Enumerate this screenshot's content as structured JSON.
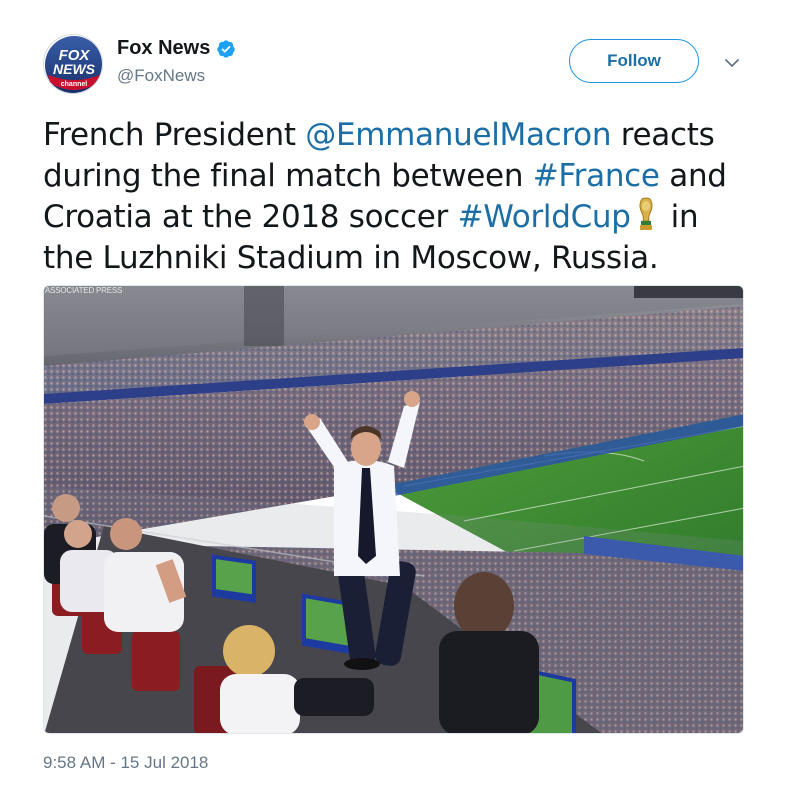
{
  "account": {
    "display_name": "Fox News",
    "handle": "@FoxNews",
    "verified": true,
    "avatar_text_1": "FOX",
    "avatar_text_2": "NEWS",
    "avatar_text_3": "channel"
  },
  "actions": {
    "follow_label": "Follow",
    "menu_icon": "chevron-down-icon"
  },
  "tweet": {
    "part_1": "French President ",
    "mention": "@EmmanuelMacron",
    "part_2": " reacts during the final match between ",
    "hashtag_1": "#France",
    "part_3": " and Croatia at the 2018 soccer ",
    "hashtag_2": "#WorldCup",
    "emoji": "trophy-icon",
    "part_4": "in the Luzhniki Stadium in Moscow, Russia."
  },
  "media": {
    "credit": "ASSOCIATED PRESS"
  },
  "timestamp": "9:58 AM - 15 Jul 2018",
  "colors": {
    "link": "#1b6fa6",
    "follow_border": "#1b95e0",
    "secondary_text": "#657786",
    "verified": "#1da1f2"
  }
}
